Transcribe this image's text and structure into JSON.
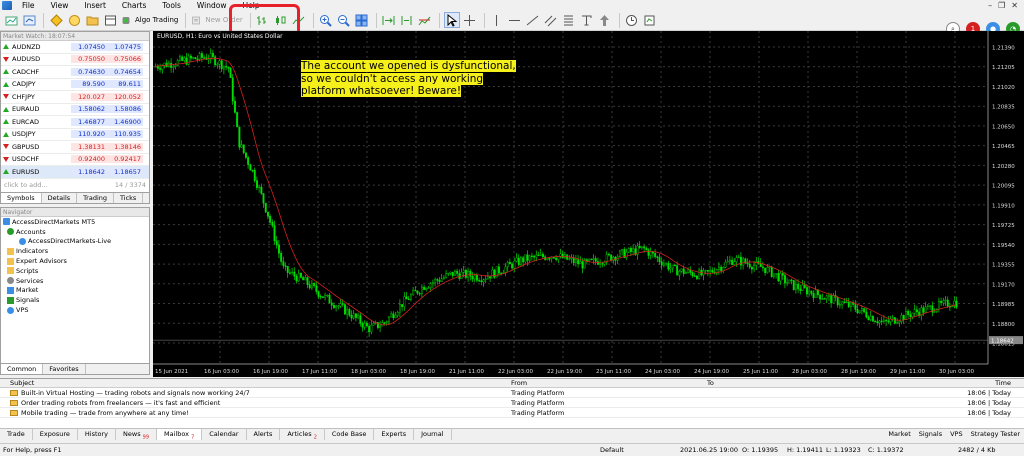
{
  "menu": [
    "File",
    "View",
    "Insert",
    "Charts",
    "Tools",
    "Window",
    "Help"
  ],
  "toolbar": {
    "algo_trading": "Algo Trading",
    "new_order": "New Order",
    "notification_count": "1"
  },
  "market_watch": {
    "header": "Market Watch: 18:07:54",
    "rows": [
      {
        "symbol": "AUDNZD",
        "bid": "1.07450",
        "ask": "1.07475",
        "dir": "up"
      },
      {
        "symbol": "AUDUSD",
        "bid": "0.75050",
        "ask": "0.75066",
        "dir": "down"
      },
      {
        "symbol": "CADCHF",
        "bid": "0.74630",
        "ask": "0.74654",
        "dir": "up"
      },
      {
        "symbol": "CADJPY",
        "bid": "89.590",
        "ask": "89.611",
        "dir": "up"
      },
      {
        "symbol": "CHFJPY",
        "bid": "120.027",
        "ask": "120.052",
        "dir": "down"
      },
      {
        "symbol": "EURAUD",
        "bid": "1.58062",
        "ask": "1.58086",
        "dir": "up"
      },
      {
        "symbol": "EURCAD",
        "bid": "1.46877",
        "ask": "1.46900",
        "dir": "up"
      },
      {
        "symbol": "USDJPY",
        "bid": "110.920",
        "ask": "110.935",
        "dir": "up"
      },
      {
        "symbol": "GBPUSD",
        "bid": "1.38131",
        "ask": "1.38146",
        "dir": "down"
      },
      {
        "symbol": "USDCHF",
        "bid": "0.92400",
        "ask": "0.92417",
        "dir": "down"
      },
      {
        "symbol": "EURUSD",
        "bid": "1.18642",
        "ask": "1.18657",
        "dir": "up"
      }
    ],
    "add_label": "click to add...",
    "count": "14 / 3374",
    "tabs": [
      "Symbols",
      "Details",
      "Trading",
      "Ticks"
    ]
  },
  "navigator": {
    "header": "Navigator",
    "broker": "AccessDirectMarkets MT5",
    "accounts": "Accounts",
    "account_name": "AccessDirectMarkets-Live",
    "items": [
      "Indicators",
      "Expert Advisors",
      "Scripts",
      "Services",
      "Market",
      "Signals",
      "VPS"
    ],
    "tabs": [
      "Common",
      "Favorites"
    ]
  },
  "chart": {
    "title": "EURUSD, H1:  Euro vs United States Dollar",
    "warning_lines": [
      "The account we opened is dysfunctional,",
      "so we couldn't access any working",
      "platform whatsoever! Beware!"
    ],
    "current_price": "1.18642",
    "price_ticks": [
      "1.21390",
      "1.21205",
      "1.21020",
      "1.20835",
      "1.20650",
      "1.20465",
      "1.20280",
      "1.20095",
      "1.19910",
      "1.19725",
      "1.19540",
      "1.19355",
      "1.19170",
      "1.18985",
      "1.18800",
      "1.18615"
    ],
    "time_ticks": [
      "15 Jun 2021",
      "16 Jun 03:00",
      "16 Jun 19:00",
      "17 Jun 11:00",
      "18 Jun 03:00",
      "18 Jun 19:00",
      "21 Jun 11:00",
      "22 Jun 03:00",
      "22 Jun 19:00",
      "23 Jun 11:00",
      "24 Jun 03:00",
      "24 Jun 19:00",
      "25 Jun 11:00",
      "28 Jun 03:00",
      "28 Jun 19:00",
      "29 Jun 11:00",
      "30 Jun 03:00"
    ]
  },
  "mailbox": {
    "columns": {
      "subject": "Subject",
      "from": "From",
      "to": "To",
      "time": "Time"
    },
    "rows": [
      {
        "subject": "Built-in Virtual Hosting — trading robots and signals now working 24/7",
        "from": "Trading Platform",
        "to": "",
        "time": "18:06 | Today"
      },
      {
        "subject": "Order trading robots from freelancers — it's fast and efficient",
        "from": "Trading Platform",
        "to": "",
        "time": "18:06 | Today"
      },
      {
        "subject": "Mobile trading — trade from anywhere at any time!",
        "from": "Trading Platform",
        "to": "",
        "time": "18:06 | Today"
      }
    ],
    "tabs": [
      {
        "label": "Trade",
        "badge": ""
      },
      {
        "label": "Exposure",
        "badge": ""
      },
      {
        "label": "History",
        "badge": ""
      },
      {
        "label": "News",
        "badge": "99"
      },
      {
        "label": "Mailbox",
        "badge": "7"
      },
      {
        "label": "Calendar",
        "badge": ""
      },
      {
        "label": "Alerts",
        "badge": ""
      },
      {
        "label": "Articles",
        "badge": "2"
      },
      {
        "label": "Code Base",
        "badge": ""
      },
      {
        "label": "Experts",
        "badge": ""
      },
      {
        "label": "Journal",
        "badge": ""
      }
    ],
    "right_links": [
      "Market",
      "Signals",
      "VPS",
      "Strategy Tester"
    ]
  },
  "status": {
    "help": "For Help, press F1",
    "profile": "Default",
    "datetime": "2021.06.25 19:00",
    "open": "O: 1.19395",
    "high": "H: 1.19411",
    "low": "L: 1.19323",
    "close": "C: 1.19372",
    "traffic": "2482 / 4 Kb"
  },
  "colors": {
    "up": "#22a822",
    "down": "#d42020",
    "candle": "#00e000",
    "highlight": "#e8202a",
    "banner": "#f5ef1a"
  }
}
